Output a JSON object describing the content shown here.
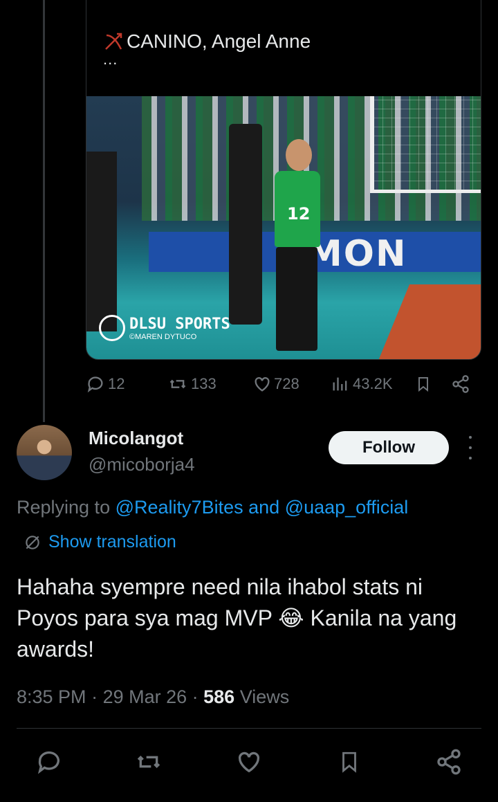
{
  "quoted_tweet": {
    "title": "CANINO, Angel Anne",
    "more": "...",
    "media": {
      "watermark_title": "DLSU SPORTS",
      "watermark_credit": "©MAREN DYTUCO",
      "jersey_number": "12",
      "banner_text": "MON"
    },
    "stats": {
      "replies": "12",
      "retweets": "133",
      "likes": "728",
      "views": "43.2K"
    }
  },
  "reply": {
    "display_name": "Micolangot",
    "handle": "@micoborja4",
    "follow_label": "Follow",
    "replying_prefix": "Replying to",
    "replying_mention_1": "@Reality7Bites",
    "replying_and": "and",
    "replying_mention_2": "@uaap_official",
    "show_translation": "Show translation",
    "text_part1": "Hahaha syempre need nila ihabol stats ni Poyos para sya mag MVP",
    "emoji": "😂",
    "text_part2": "Kanila na yang awards!",
    "time": "8:35 PM",
    "date": "29 Mar 26",
    "views_count": "586",
    "views_label": "Views"
  },
  "colors": {
    "accent": "#1d9bf0",
    "muted": "#71767b",
    "background": "#000000"
  }
}
